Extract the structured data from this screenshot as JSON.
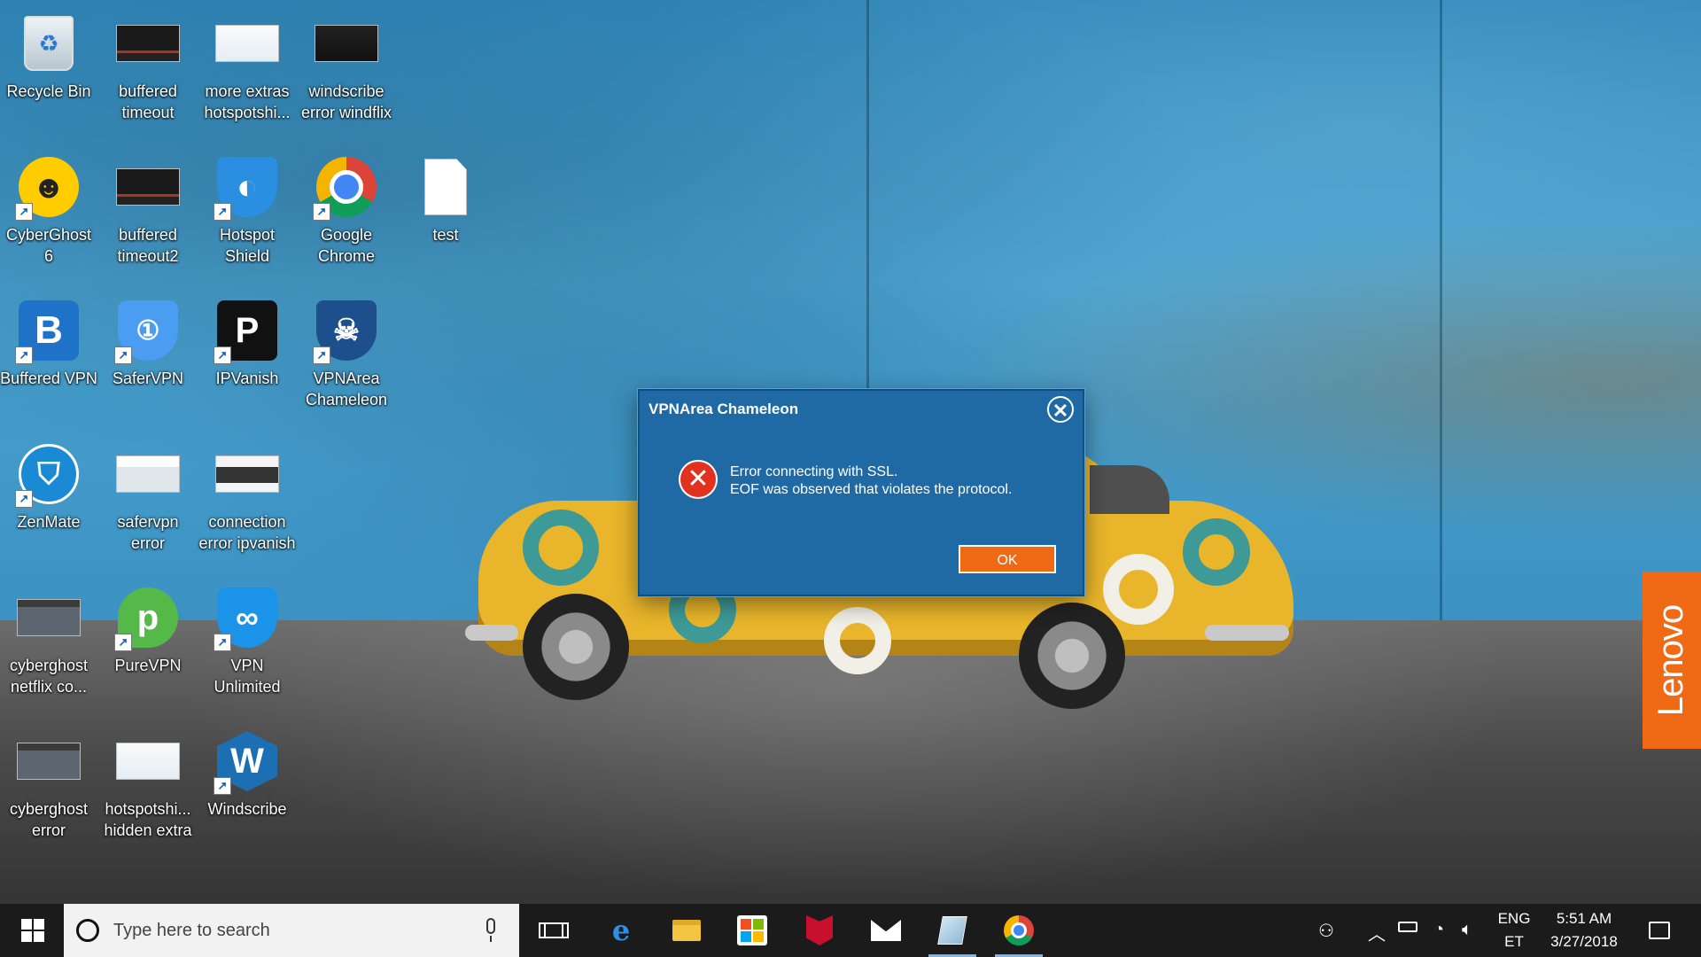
{
  "desktop": {
    "icons": [
      {
        "label": "Recycle Bin",
        "icon": "recycle-bin-icon"
      },
      {
        "label": "buffered timeout",
        "icon": "screenshot-thumbnail-icon"
      },
      {
        "label": "more extras hotspotshi...",
        "icon": "screenshot-thumbnail-icon"
      },
      {
        "label": "windscribe error windflix",
        "icon": "screenshot-thumbnail-icon"
      },
      {
        "label": "CyberGhost 6",
        "icon": "cyberghost-icon"
      },
      {
        "label": "buffered timeout2",
        "icon": "screenshot-thumbnail-icon"
      },
      {
        "label": "Hotspot Shield",
        "icon": "hotspot-shield-icon"
      },
      {
        "label": "Google Chrome",
        "icon": "chrome-icon"
      },
      {
        "label": "test",
        "icon": "text-file-icon"
      },
      {
        "label": "Buffered VPN",
        "icon": "buffered-vpn-icon"
      },
      {
        "label": "SaferVPN",
        "icon": "safervpn-icon"
      },
      {
        "label": "IPVanish",
        "icon": "ipvanish-icon"
      },
      {
        "label": "VPNArea Chameleon",
        "icon": "vpnarea-chameleon-icon"
      },
      {
        "label": "ZenMate",
        "icon": "zenmate-icon"
      },
      {
        "label": "safervpn error",
        "icon": "screenshot-thumbnail-icon"
      },
      {
        "label": "connection error ipvanish",
        "icon": "screenshot-thumbnail-icon"
      },
      {
        "label": "cyberghost netflix co...",
        "icon": "screenshot-thumbnail-icon"
      },
      {
        "label": "PureVPN",
        "icon": "purevpn-icon"
      },
      {
        "label": "VPN Unlimited",
        "icon": "vpn-unlimited-icon"
      },
      {
        "label": "cyberghost error",
        "icon": "screenshot-thumbnail-icon"
      },
      {
        "label": "hotspotshi... hidden extra",
        "icon": "screenshot-thumbnail-icon"
      },
      {
        "label": "Windscribe",
        "icon": "windscribe-icon"
      }
    ]
  },
  "wallpaper": {
    "brand_text": "Lenovo",
    "brand_color": "#f06a16"
  },
  "dialog": {
    "title": "VPNArea Chameleon",
    "message_line1": "Error connecting with SSL.",
    "message_line2": "EOF was observed that violates the protocol.",
    "ok_label": "OK",
    "close_glyph": "✕",
    "error_glyph": "✕",
    "background_color": "#1f6aa5",
    "button_color": "#f06a16"
  },
  "taskbar": {
    "search_placeholder": "Type here to search",
    "pinned": [
      "task-view-icon",
      "edge-icon",
      "file-explorer-icon",
      "store-icon",
      "mcafee-icon",
      "mail-icon",
      "notes-icon",
      "chrome-icon"
    ],
    "tray": {
      "language_top": "ENG",
      "language_bottom": "ET",
      "time": "5:51 AM",
      "date": "3/27/2018"
    }
  }
}
